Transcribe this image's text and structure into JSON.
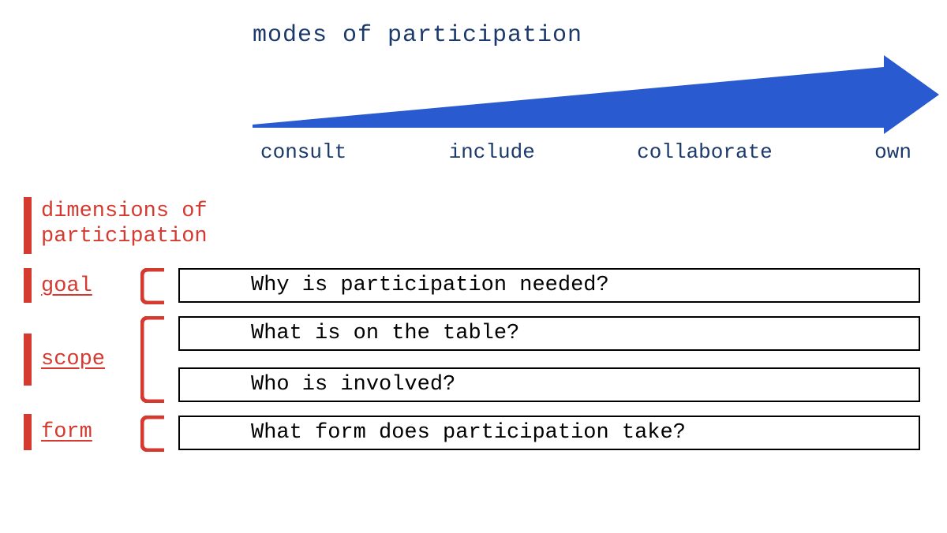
{
  "modes": {
    "title": "modes of participation",
    "labels": [
      "consult",
      "include",
      "collaborate",
      "own"
    ]
  },
  "dimensions": {
    "title": "dimensions of participation",
    "items": [
      {
        "label": "goal",
        "questions": [
          "Why is participation needed?"
        ]
      },
      {
        "label": "scope",
        "questions": [
          "What is on the table?",
          "Who is involved?"
        ]
      },
      {
        "label": "form",
        "questions": [
          "What form does participation take?"
        ]
      }
    ]
  },
  "colors": {
    "navy": "#1b3a6b",
    "blue": "#2a5ad0",
    "red": "#d43a2f"
  }
}
